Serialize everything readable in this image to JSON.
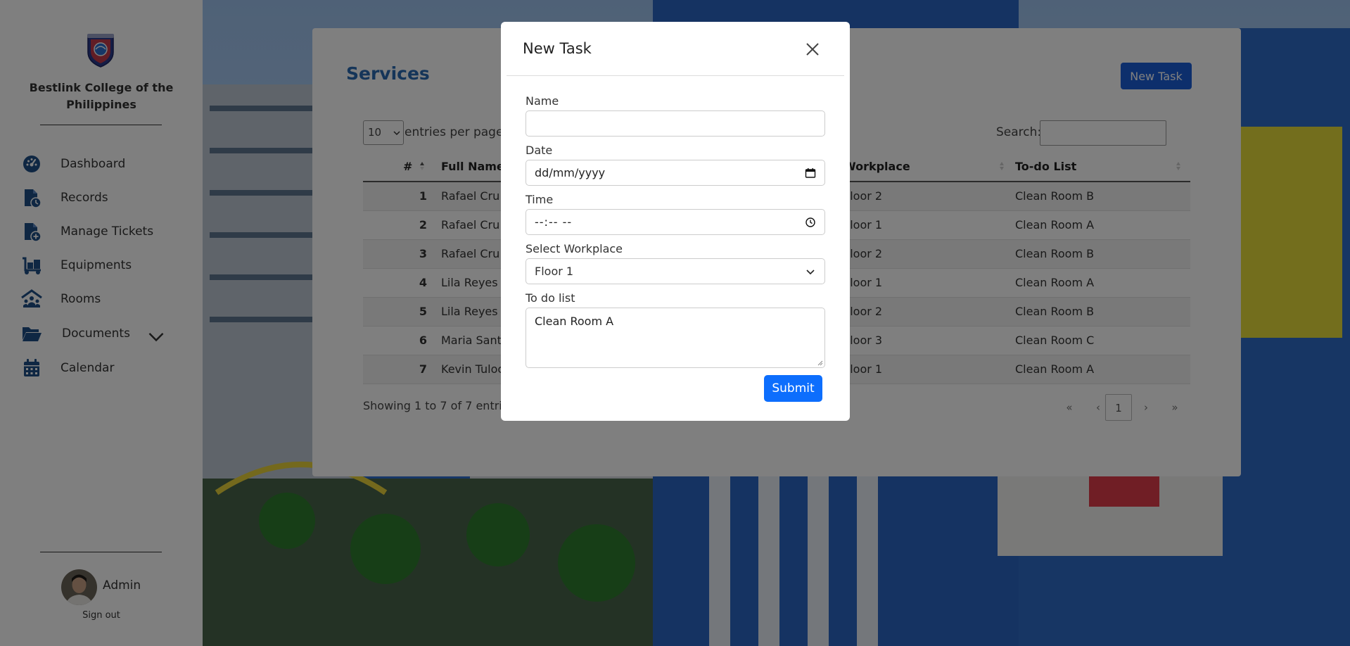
{
  "sidebar": {
    "college_name": "Bestlink College of the Philippines",
    "nav": [
      {
        "label": "Dashboard",
        "icon": "dashboard-gauge-icon"
      },
      {
        "label": "Records",
        "icon": "records-file-icon"
      },
      {
        "label": "Manage Tickets",
        "icon": "ticket-file-plus-icon"
      },
      {
        "label": "Equipments",
        "icon": "dolly-cart-icon"
      },
      {
        "label": "Rooms",
        "icon": "people-roof-icon"
      },
      {
        "label": "Documents",
        "icon": "folder-open-icon"
      },
      {
        "label": "Calendar",
        "icon": "calendar-icon"
      }
    ],
    "user": {
      "name": "Admin",
      "signout": "Sign out"
    }
  },
  "services": {
    "title": "Services",
    "new_task_button": "New Task",
    "per_page_value": "10",
    "per_page_label": "entries per page",
    "search_label": "Search:",
    "columns": [
      "#",
      "Full Name",
      "Workplace",
      "To-do List"
    ],
    "rows": [
      {
        "num": "1",
        "name": "Rafael Cru",
        "workplace": "Floor 2",
        "todo": "Clean Room B"
      },
      {
        "num": "2",
        "name": "Rafael Cru",
        "workplace": "Floor 1",
        "todo": "Clean Room A"
      },
      {
        "num": "3",
        "name": "Rafael Cru",
        "workplace": "Floor 2",
        "todo": "Clean Room B"
      },
      {
        "num": "4",
        "name": "Lila Reyes",
        "workplace": "Floor 1",
        "todo": "Clean Room A"
      },
      {
        "num": "5",
        "name": "Lila Reyes",
        "workplace": "Floor 2",
        "todo": "Clean Room B"
      },
      {
        "num": "6",
        "name": "Maria Sant",
        "workplace": "Floor 3",
        "todo": "Clean Room C"
      },
      {
        "num": "7",
        "name": "Kevin Tuloc",
        "workplace": "Floor 1",
        "todo": "Clean Room A"
      }
    ],
    "showing": "Showing 1 to 7 of 7 entrie",
    "pager": {
      "first": "«",
      "prev": "‹",
      "current": "1",
      "next": "›",
      "last": "»"
    }
  },
  "modal": {
    "title": "New Task",
    "name_label": "Name",
    "name_value": "",
    "date_label": "Date",
    "date_placeholder": "dd/mm/yyyy",
    "time_label": "Time",
    "time_placeholder": "--:-- --",
    "workplace_label": "Select Workplace",
    "workplace_value": "Floor 1",
    "todo_label": "To do list",
    "todo_value": "Clean Room A",
    "submit": "Submit"
  },
  "colors": {
    "primary": "#0d6efd",
    "title_blue": "#2a6bb3",
    "nav_icon": "#1f4f86"
  }
}
